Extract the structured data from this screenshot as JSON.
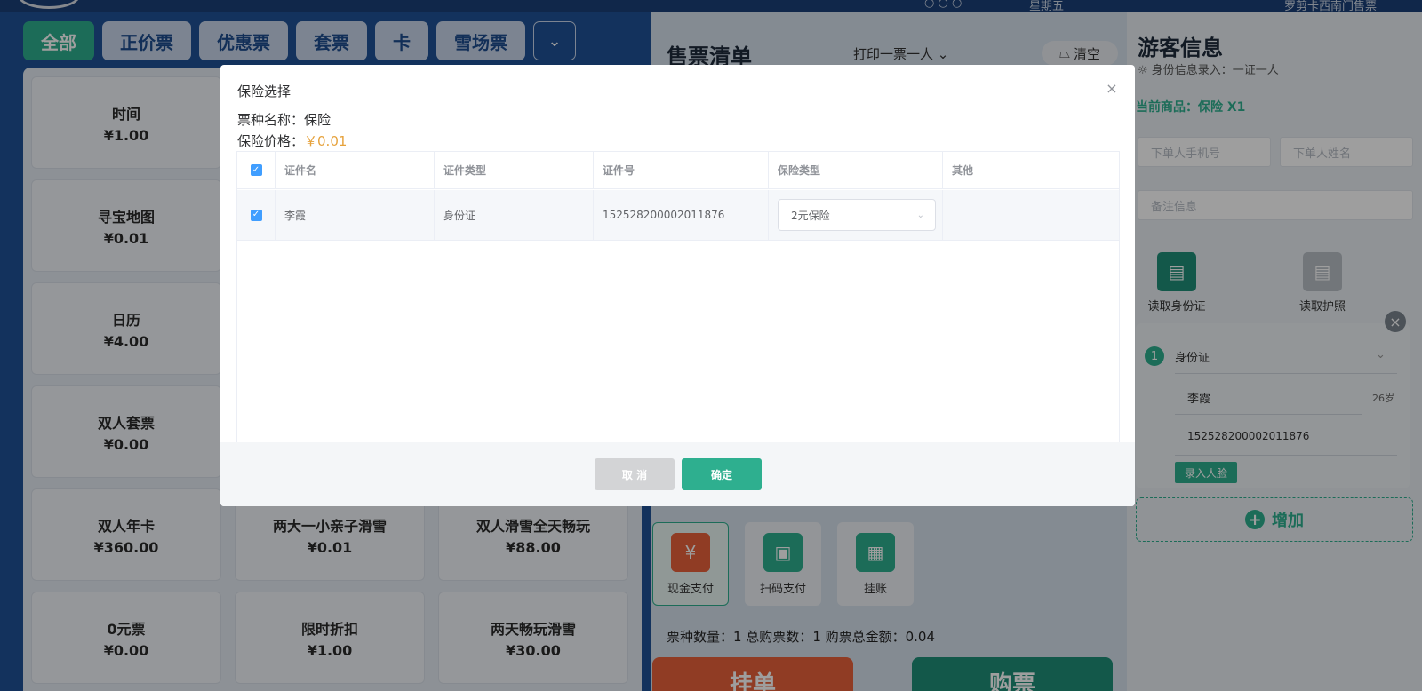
{
  "header": {
    "misc_left": "○ ○ ○",
    "misc_center": "星期五",
    "misc_right": "罗剪卡西南门售票"
  },
  "categories": {
    "tabs": [
      "全部",
      "正价票",
      "优惠票",
      "套票",
      "卡",
      "雪场票"
    ],
    "active": "全部"
  },
  "products": [
    {
      "name": "时间",
      "price": "¥1.00"
    },
    {
      "name": "寻宝地图",
      "price": "¥0.01"
    },
    {
      "name": "日历",
      "price": "¥4.00"
    },
    {
      "name": "双人套票",
      "price": "¥0.00"
    },
    {
      "name": "双人年卡",
      "price": "¥360.00"
    },
    {
      "name": "两大一小亲子滑雪",
      "price": "¥0.01"
    },
    {
      "name": "双人滑雪全天畅玩",
      "price": "¥88.00"
    },
    {
      "name": "0元票",
      "price": "¥0.00"
    },
    {
      "name": "限时折扣",
      "price": "¥1.00"
    },
    {
      "name": "两天畅玩滑雪",
      "price": "¥30.00"
    }
  ],
  "order": {
    "title": "售票清单",
    "print_mode": "打印一票一人",
    "clear_label": "清空",
    "payments": [
      {
        "label": "现金支付",
        "icon": "cash-icon",
        "color": "#e8623a"
      },
      {
        "label": "扫码支付",
        "icon": "scan-icon",
        "color": "#2eaf8f"
      },
      {
        "label": "挂账",
        "icon": "ledger-icon",
        "color": "#2eaf8f"
      }
    ],
    "summary": "票种数量：1 总购票数：1 购票总金额：0.04",
    "hold_label": "挂单",
    "buy_label": "购票"
  },
  "visitor": {
    "title": "游客信息",
    "hint": "身份信息录入：一证一人",
    "current": "当前商品：保险 X1",
    "phone_placeholder": "下单人手机号",
    "name_placeholder": "下单人姓名",
    "remark_placeholder": "备注信息",
    "read_id": "读取身份证",
    "read_passport": "读取护照",
    "card": {
      "index": "1",
      "id_type": "身份证",
      "name": "李霞",
      "age": "26岁",
      "id_no": "152528200002011876",
      "face_label": "录入人脸"
    },
    "add_label": "增加"
  },
  "modal": {
    "title": "保险选择",
    "ticket_name_label": "票种名称：",
    "ticket_name": "保险",
    "price_label": "保险价格：",
    "price": "￥0.01",
    "columns": [
      "证件名",
      "证件类型",
      "证件号",
      "保险类型",
      "其他"
    ],
    "rows": [
      {
        "name": "李霞",
        "id_type": "身份证",
        "id_no": "152528200002011876",
        "insurance": "2元保险",
        "other": ""
      }
    ],
    "cancel_label": "取 消",
    "ok_label": "确定"
  },
  "colors": {
    "accent": "#2eaf8f",
    "primary": "#409eff",
    "warning": "#e6a23c",
    "orange": "#e8623a"
  }
}
